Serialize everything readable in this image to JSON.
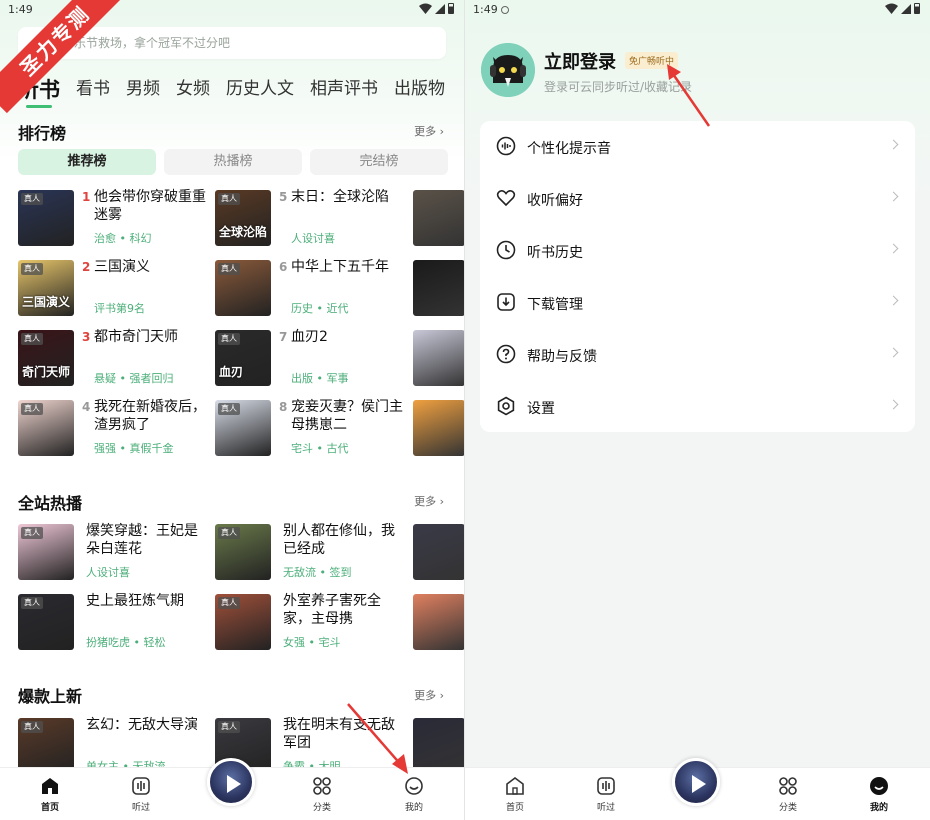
{
  "status": {
    "time": "1:49"
  },
  "watermark": "圣力专测",
  "left": {
    "search_placeholder": "音乐节救场，拿个冠军不过分吧",
    "tabs": [
      "听书",
      "看书",
      "男频",
      "女频",
      "历史人文",
      "相声评书",
      "出版物"
    ],
    "ranking": {
      "title": "排行榜",
      "more": "更多",
      "segments": [
        "推荐榜",
        "热播榜",
        "完结榜"
      ],
      "items": [
        {
          "rank": "1",
          "title": "他会带你穿破重重迷雾",
          "sub": "治愈 • 科幻",
          "tag": "真人",
          "ctext": ""
        },
        {
          "rank": "5",
          "title": "末日：全球沦陷",
          "sub": "人设讨喜",
          "tag": "真人",
          "ctext": "全球沦陷"
        },
        {
          "rank": "2",
          "title": "三国演义",
          "sub": "评书第9名",
          "tag": "真人",
          "ctext": "三国演义"
        },
        {
          "rank": "6",
          "title": "中华上下五千年",
          "sub": "历史 • 近代",
          "tag": "真人",
          "ctext": ""
        },
        {
          "rank": "3",
          "title": "都市奇门天师",
          "sub": "悬疑 • 强者回归",
          "tag": "真人",
          "ctext": "奇门天师"
        },
        {
          "rank": "7",
          "title": "血刃2",
          "sub": "出版 • 军事",
          "tag": "真人",
          "ctext": "血刃"
        },
        {
          "rank": "4",
          "title": "我死在新婚夜后，渣男疯了",
          "sub": "强强 • 真假千金",
          "tag": "真人",
          "ctext": ""
        },
        {
          "rank": "8",
          "title": "宠妾灭妻？侯门主母携崽二",
          "sub": "宅斗 • 古代",
          "tag": "真人",
          "ctext": ""
        }
      ]
    },
    "hot": {
      "title": "全站热播",
      "more": "更多",
      "items": [
        {
          "title": "爆笑穿越：王妃是朵白莲花",
          "sub": "人设讨喜",
          "tag": "真人"
        },
        {
          "title": "别人都在修仙，我已经成",
          "sub": "无敌流 • 签到",
          "tag": "真人"
        },
        {
          "title": "史上最狂炼气期",
          "sub": "扮猪吃虎 • 轻松",
          "tag": "真人"
        },
        {
          "title": "外室养子害死全家，主母携",
          "sub": "女强 • 宅斗",
          "tag": "真人"
        }
      ]
    },
    "newhot": {
      "title": "爆款上新",
      "more": "更多",
      "items": [
        {
          "title": "玄幻：无敌大导演",
          "sub": "单女主 • 无敌流",
          "tag": "真人"
        },
        {
          "title": "我在明末有支无敌军团",
          "sub": "争霸 • 大明",
          "tag": "真人"
        }
      ]
    },
    "nav": [
      "首页",
      "听过",
      "",
      "分类",
      "我的"
    ]
  },
  "right": {
    "login_title": "立即登录",
    "ad_badge": "免广畅听中",
    "login_sub": "登录可云同步听过/收藏记录",
    "menu": [
      "个性化提示音",
      "收听偏好",
      "听书历史",
      "下载管理",
      "帮助与反馈",
      "设置"
    ],
    "nav": [
      "首页",
      "听过",
      "",
      "分类",
      "我的"
    ]
  },
  "colors": {
    "accent": "#3fbf73",
    "rank_red": "#e0443e",
    "rank_gray": "#999999",
    "sub_green": "#4caf7a",
    "arrow_red": "#e53935"
  }
}
